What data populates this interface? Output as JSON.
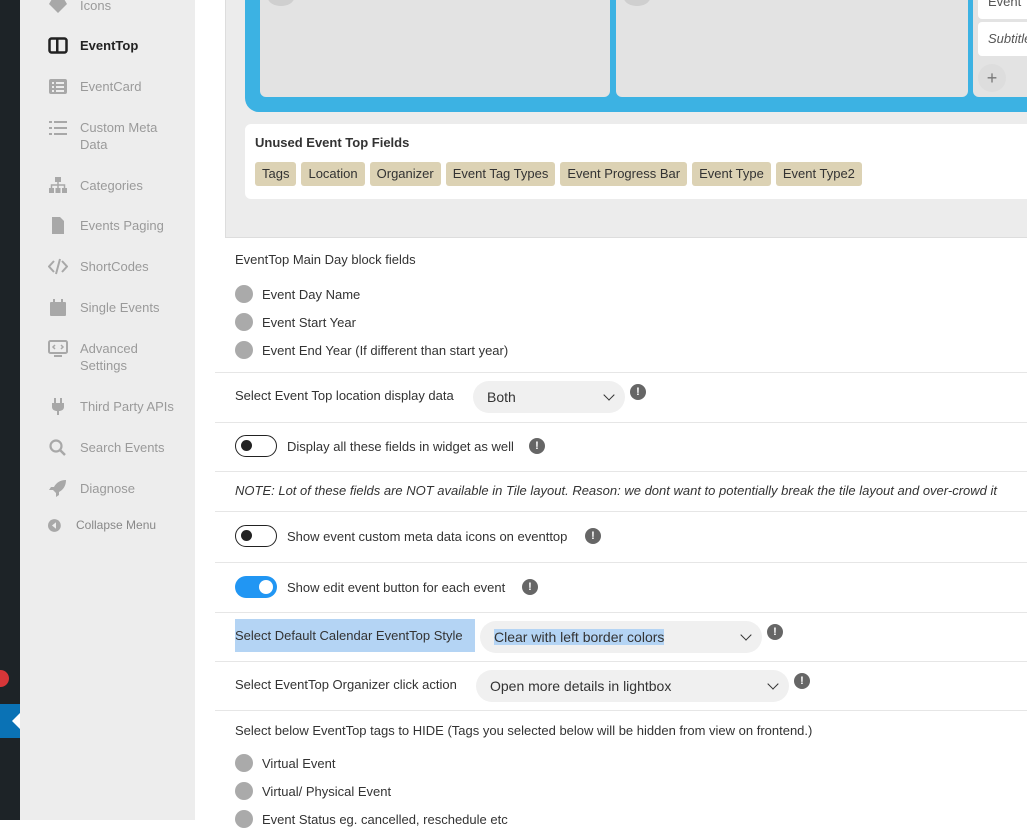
{
  "sidebar": {
    "items": [
      {
        "label": "Icons",
        "icon": "diamond-icon"
      },
      {
        "label": "EventTop",
        "icon": "layout-icon"
      },
      {
        "label": "EventCard",
        "icon": "list-card-icon"
      },
      {
        "label": "Custom Meta Data",
        "icon": "list-icon"
      },
      {
        "label": "Categories",
        "icon": "sitemap-icon"
      },
      {
        "label": "Events Paging",
        "icon": "file-icon"
      },
      {
        "label": "ShortCodes",
        "icon": "code-icon"
      },
      {
        "label": "Single Events",
        "icon": "calendar-icon"
      },
      {
        "label": "Advanced Settings",
        "icon": "monitor-icon"
      },
      {
        "label": "Third Party APIs",
        "icon": "plug-icon"
      },
      {
        "label": "Search Events",
        "icon": "search-icon"
      },
      {
        "label": "Diagnose",
        "icon": "rocket-icon"
      }
    ],
    "collapse_label": "Collapse Menu"
  },
  "layout_builder": {
    "mini_field_1": "Event",
    "mini_field_2": "Subtitle",
    "add_symbol": "+"
  },
  "unused": {
    "title": "Unused Event Top Fields",
    "tags": [
      "Tags",
      "Location",
      "Organizer",
      "Event Tag Types",
      "Event Progress Bar",
      "Event Type",
      "Event Type2"
    ]
  },
  "day_block": {
    "title": "EventTop Main Day block fields",
    "options": [
      "Event Day Name",
      "Event Start Year",
      "Event End Year (If different than start year)"
    ]
  },
  "location_display": {
    "label": "Select Event Top location display data",
    "value": "Both"
  },
  "widget_toggle": {
    "label": "Display all these fields in widget as well",
    "state": "off"
  },
  "note": "NOTE: Lot of these fields are NOT available in Tile layout. Reason: we dont want to potentially break the tile layout and over-crowd it",
  "meta_icons_toggle": {
    "label": "Show event custom meta data icons on eventtop",
    "state": "off"
  },
  "edit_button_toggle": {
    "label": "Show edit event button for each event",
    "state": "on"
  },
  "calendar_style": {
    "label": "Select Default Calendar EventTop Style",
    "value": "Clear with left border colors"
  },
  "organizer_action": {
    "label": "Select EventTop Organizer click action",
    "value": "Open more details in lightbox"
  },
  "hide_tags": {
    "title": "Select below EventTop tags to HIDE (Tags you selected below will be hidden from view on frontend.)",
    "options": [
      "Virtual Event",
      "Virtual/ Physical Event",
      "Event Status eg. cancelled, reschedule etc"
    ]
  },
  "info_symbol": "!"
}
